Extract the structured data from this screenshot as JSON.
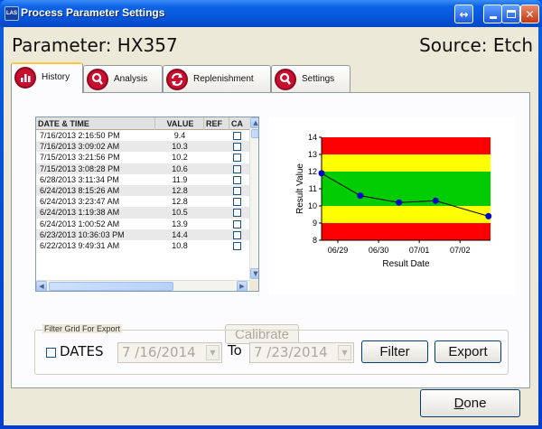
{
  "window": {
    "title": "Process Parameter Settings",
    "icon_text": "LAS"
  },
  "header": {
    "parameter": "Parameter: HX357",
    "source": "Source: Etch"
  },
  "tabs": [
    {
      "label": "History",
      "icon": "chart-icon",
      "active": true
    },
    {
      "label": "Analysis",
      "icon": "magnifier-icon",
      "active": false
    },
    {
      "label": "Replenishment",
      "icon": "refresh-icon",
      "active": false
    },
    {
      "label": "Settings",
      "icon": "magnifier-icon",
      "active": false
    }
  ],
  "grid": {
    "columns": [
      "DATE & TIME",
      "VALUE",
      "REF",
      "CA"
    ],
    "rows": [
      {
        "date": "7/16/2013 2:16:50 PM",
        "value": "9.4",
        "ref": false,
        "ca": false
      },
      {
        "date": "7/16/2013 3:09:02 AM",
        "value": "10.3",
        "ref": false,
        "ca": false
      },
      {
        "date": "7/15/2013 3:21:56 PM",
        "value": "10.2",
        "ref": false,
        "ca": false
      },
      {
        "date": "7/15/2013 3:08:28 PM",
        "value": "10.6",
        "ref": false,
        "ca": false
      },
      {
        "date": "6/28/2013 3:11:34 PM",
        "value": "11.9",
        "ref": false,
        "ca": false
      },
      {
        "date": "6/24/2013 8:15:26 AM",
        "value": "12.8",
        "ref": false,
        "ca": false
      },
      {
        "date": "6/24/2013 3:23:47 AM",
        "value": "12.8",
        "ref": false,
        "ca": false
      },
      {
        "date": "6/24/2013 1:19:38 AM",
        "value": "10.5",
        "ref": false,
        "ca": false
      },
      {
        "date": "6/24/2013 1:00:52 AM",
        "value": "13.9",
        "ref": false,
        "ca": false
      },
      {
        "date": "6/23/2013 10:36:03 PM",
        "value": "14.4",
        "ref": false,
        "ca": false
      },
      {
        "date": "6/22/2013 9:49:31 AM",
        "value": "10.8",
        "ref": false,
        "ca": false
      }
    ]
  },
  "chart_data": {
    "type": "line",
    "xlabel": "Result Date",
    "ylabel": "Result Value",
    "ylim": [
      8,
      14
    ],
    "yticks": [
      "8",
      "9",
      "10",
      "11",
      "12",
      "13",
      "14"
    ],
    "xticks": [
      "06/29",
      "06/30",
      "07/01",
      "07/02"
    ],
    "xtick_values": [
      29,
      30,
      31,
      32
    ],
    "xlim": [
      28.6,
      32.75
    ],
    "bands": [
      {
        "from": 8,
        "to": 9,
        "color": "#ff0000"
      },
      {
        "from": 9,
        "to": 10,
        "color": "#ffff00"
      },
      {
        "from": 10,
        "to": 12,
        "color": "#00cc00"
      },
      {
        "from": 12,
        "to": 13,
        "color": "#ffff00"
      },
      {
        "from": 13,
        "to": 14,
        "color": "#ff0000"
      }
    ],
    "series": [
      {
        "x": [
          28.6,
          29.55,
          30.5,
          31.4,
          32.7
        ],
        "values": [
          11.9,
          10.6,
          10.2,
          10.3,
          9.4
        ],
        "color": "#0000cc"
      }
    ]
  },
  "buttons": {
    "calibrate": "Calibrate",
    "filter": "Filter",
    "export": "Export",
    "done_prefix": "D",
    "done_rest": "one"
  },
  "filter": {
    "group_label": "Filter Grid For Export",
    "dates_label": "DATES",
    "dates_checked": false,
    "from_date": "7 /16/2014",
    "to_label": "To",
    "to_date": "7 /23/2014"
  }
}
